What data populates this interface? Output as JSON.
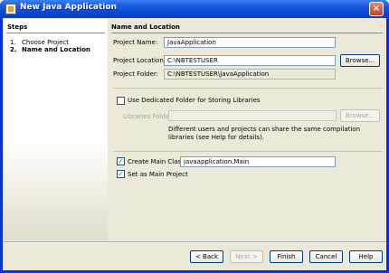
{
  "window": {
    "title": "New Java Application",
    "close_symbol": "×"
  },
  "steps": {
    "heading": "Steps",
    "items": [
      {
        "num": "1.",
        "label": "Choose Project"
      },
      {
        "num": "2.",
        "label": "Name and Location"
      }
    ]
  },
  "main": {
    "heading": "Name and Location",
    "project_name_label": "Project Name:",
    "project_name_value": "JavaApplication",
    "project_location_label": "Project Location:",
    "project_location_value": "C:\\NBTESTUSER",
    "browse_label": "Browse...",
    "project_folder_label": "Project Folder:",
    "project_folder_value": "C:\\NBTESTUSER\\JavaApplication",
    "dedicated_folder_label": "Use Dedicated Folder for Storing Libraries",
    "dedicated_folder_checked": false,
    "libraries_folder_label": "Libraries Folder:",
    "libraries_folder_value": "",
    "libraries_browse_label": "Browse...",
    "libraries_note_line1": "Different users and projects can share the same compilation",
    "libraries_note_line2": "libraries (see Help for details).",
    "create_main_class_label": "Create Main Class",
    "create_main_class_checked": true,
    "main_class_value": "javaapplication.Main",
    "set_main_project_label": "Set as Main Project",
    "set_main_project_checked": true
  },
  "footer": {
    "back_label": "< Back",
    "next_label": "Next >",
    "finish_label": "Finish",
    "cancel_label": "Cancel",
    "help_label": "Help"
  },
  "icons": {
    "checkmark": "✓"
  },
  "colors": {
    "titlebar": "#0a46d3",
    "dialog_bg": "#ece9d8",
    "button_border": "#003c74",
    "check_green": "#21a121"
  }
}
